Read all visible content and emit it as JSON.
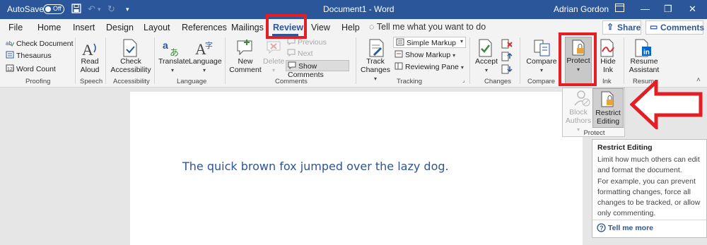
{
  "titlebar": {
    "autosave_label": "AutoSave",
    "autosave_state": "Off",
    "document_title": "Document1  -  Word",
    "user_name": "Adrian Gordon"
  },
  "tabs": [
    {
      "label": "File"
    },
    {
      "label": "Home"
    },
    {
      "label": "Insert"
    },
    {
      "label": "Design"
    },
    {
      "label": "Layout"
    },
    {
      "label": "References"
    },
    {
      "label": "Mailings"
    },
    {
      "label": "Review"
    },
    {
      "label": "View"
    },
    {
      "label": "Help"
    }
  ],
  "tellme_placeholder": "Tell me what you want to do",
  "share_label": "Share",
  "comments_label": "Comments",
  "ribbon": {
    "proofing": {
      "check_document": "Check Document",
      "thesaurus": "Thesaurus",
      "word_count": "Word Count",
      "group": "Proofing"
    },
    "speech": {
      "read_aloud_1": "Read",
      "read_aloud_2": "Aloud",
      "group": "Speech"
    },
    "accessibility": {
      "check_1": "Check",
      "check_2": "Accessibility",
      "group": "Accessibility"
    },
    "language": {
      "translate": "Translate",
      "language": "Language",
      "group": "Language"
    },
    "comments": {
      "new_1": "New",
      "new_2": "Comment",
      "delete": "Delete",
      "previous": "Previous",
      "next": "Next",
      "show_comments": "Show Comments",
      "group": "Comments"
    },
    "tracking": {
      "track_1": "Track",
      "track_2": "Changes",
      "simple_markup": "Simple Markup",
      "show_markup": "Show Markup",
      "reviewing_pane": "Reviewing Pane",
      "group": "Tracking"
    },
    "changes": {
      "accept": "Accept",
      "group": "Changes"
    },
    "compare": {
      "compare": "Compare",
      "group": "Compare"
    },
    "protect": {
      "protect": "Protect"
    },
    "ink": {
      "hide_1": "Hide",
      "hide_2": "Ink",
      "group": "Ink"
    },
    "resume": {
      "resume_1": "Resume",
      "resume_2": "Assistant",
      "group": "Resume"
    }
  },
  "flyout": {
    "block_1": "Block",
    "block_2": "Authors",
    "restrict_1": "Restrict",
    "restrict_2": "Editing",
    "group": "Protect"
  },
  "tooltip": {
    "title": "Restrict Editing",
    "body1": "Limit how much others can edit and format the document.",
    "body2": "For example, you can prevent formatting changes, force all changes to be tracked, or allow only commenting.",
    "more": "Tell me more"
  },
  "document": {
    "text": "The quick brown fox jumped over the lazy dog."
  },
  "colors": {
    "accent": "#2b579a",
    "annotation": "#e31e24",
    "body_text": "#2f5496"
  }
}
